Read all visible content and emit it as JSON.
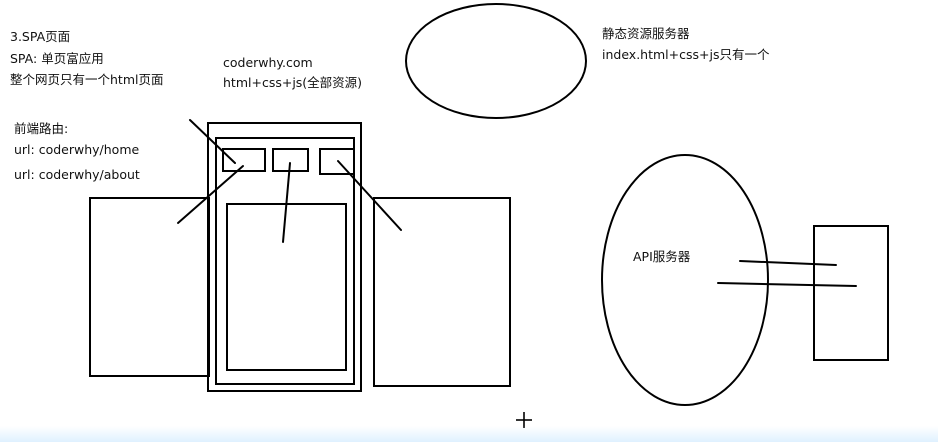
{
  "notes": {
    "spa_title": "3.SPA页面",
    "spa_definition": "SPA: 单页富应用",
    "spa_description": "整个网页只有一个html页面",
    "router_title": "前端路由:",
    "route_home": "url: coderwhy/home",
    "route_about": "url: coderwhy/about",
    "site_url": "coderwhy.com",
    "site_assets": "html+css+js(全部资源)",
    "static_server_title": "静态资源服务器",
    "static_server_desc": "index.html+css+js只有一个",
    "api_server_label": "API服务器"
  },
  "colors": {
    "stroke": "#000000",
    "text": "#111111",
    "background": "#ffffff",
    "bottom_tint": "#d2ebff"
  }
}
